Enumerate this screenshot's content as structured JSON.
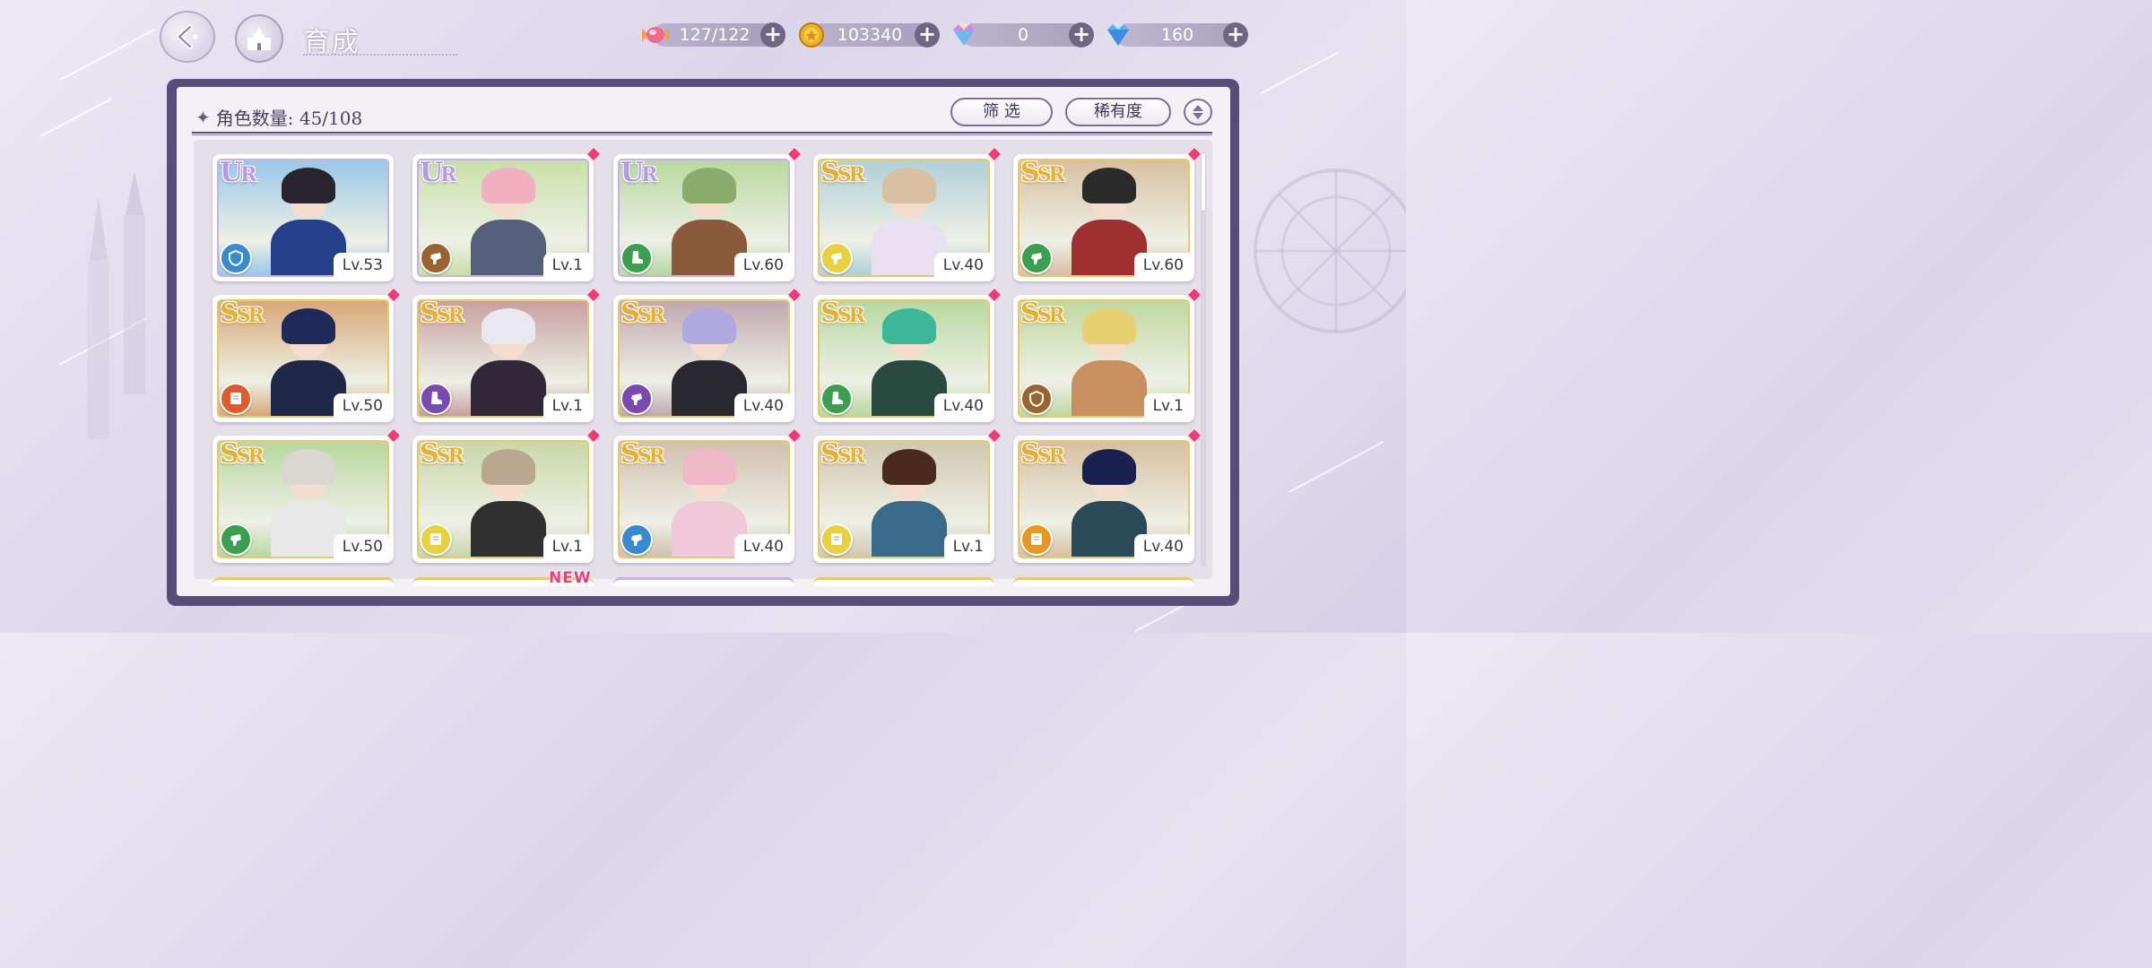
{
  "header": {
    "title": "育成",
    "back_icon": "back-arrow-icon",
    "home_icon": "castle-icon"
  },
  "currencies": [
    {
      "name": "candy",
      "icon": "candy-icon",
      "value": "127/122"
    },
    {
      "name": "gold",
      "icon": "gold-coin-icon",
      "value": "103340"
    },
    {
      "name": "rainbow-gem",
      "icon": "rainbow-gem-icon",
      "value": "0"
    },
    {
      "name": "diamond",
      "icon": "diamond-icon",
      "value": "160"
    }
  ],
  "panel": {
    "count_label": "角色数量: 45/108",
    "filter_label": "筛 选",
    "rarity_label": "稀有度"
  },
  "cards": [
    {
      "rarity": "UR",
      "level": "Lv.53",
      "role_color": "#3a8ad0",
      "role_icon": "shield-icon",
      "hair": "#2a2430",
      "outfit": "#24408a",
      "bg": "#9ac8e8"
    },
    {
      "rarity": "UR",
      "level": "Lv.1",
      "role_color": "#9a6430",
      "role_icon": "fist-icon",
      "hair": "#f0b0c0",
      "outfit": "#56607a",
      "bg": "#c8e0a8"
    },
    {
      "rarity": "UR",
      "level": "Lv.60",
      "role_color": "#3aa050",
      "role_icon": "boot-icon",
      "hair": "#8aac6a",
      "outfit": "#8a5a3a",
      "bg": "#b8d8a0"
    },
    {
      "rarity": "SSR",
      "level": "Lv.40",
      "role_color": "#e8d040",
      "role_icon": "fist-icon",
      "hair": "#d8c0a0",
      "outfit": "#e8e0f0",
      "bg": "#b0d0d8"
    },
    {
      "rarity": "SSR",
      "level": "Lv.60",
      "role_color": "#3aa050",
      "role_icon": "fist-icon",
      "hair": "#2a2a2a",
      "outfit": "#a03030",
      "bg": "#d8c0a0"
    },
    {
      "rarity": "SSR",
      "level": "Lv.50",
      "role_color": "#e05a2a",
      "role_icon": "book-icon",
      "hair": "#1e2a5a",
      "outfit": "#20284a",
      "bg": "#d8a878"
    },
    {
      "rarity": "SSR",
      "level": "Lv.1",
      "role_color": "#7a4ab0",
      "role_icon": "boot-icon",
      "hair": "#e8e8ee",
      "outfit": "#302838",
      "bg": "#c8a0a0"
    },
    {
      "rarity": "SSR",
      "level": "Lv.40",
      "role_color": "#7a4ab0",
      "role_icon": "fist-icon",
      "hair": "#b0a8e0",
      "outfit": "#2a2830",
      "bg": "#c0a8b0"
    },
    {
      "rarity": "SSR",
      "level": "Lv.40",
      "role_color": "#3aa050",
      "role_icon": "boot-icon",
      "hair": "#3ab898",
      "outfit": "#2a4a40",
      "bg": "#b8d8a0"
    },
    {
      "rarity": "SSR",
      "level": "Lv.1",
      "role_color": "#9a6430",
      "role_icon": "shield-icon",
      "hair": "#e8d070",
      "outfit": "#c89060",
      "bg": "#c0d8a0"
    },
    {
      "rarity": "SSR",
      "level": "Lv.50",
      "role_color": "#3aa050",
      "role_icon": "fist-icon",
      "hair": "#d8d8d0",
      "outfit": "#e8e8e8",
      "bg": "#b8d8a0"
    },
    {
      "rarity": "SSR",
      "level": "Lv.1",
      "role_color": "#e8d040",
      "role_icon": "book-icon",
      "hair": "#b8a890",
      "outfit": "#303030",
      "bg": "#c8d8a8"
    },
    {
      "rarity": "SSR",
      "level": "Lv.40",
      "role_color": "#3a8ad0",
      "role_icon": "fist-icon",
      "hair": "#f0b8c8",
      "outfit": "#f0c8d8",
      "bg": "#d0c0b0"
    },
    {
      "rarity": "SSR",
      "level": "Lv.1",
      "role_color": "#e8d040",
      "role_icon": "book-icon",
      "hair": "#4a2a1a",
      "outfit": "#3a6a8a",
      "bg": "#d0c8b0"
    },
    {
      "rarity": "SSR",
      "level": "Lv.40",
      "role_color": "#e89820",
      "role_icon": "book-icon",
      "hair": "#1a2050",
      "outfit": "#2a4a5a",
      "bg": "#d8c0a0"
    }
  ],
  "new_badge": "NEW"
}
